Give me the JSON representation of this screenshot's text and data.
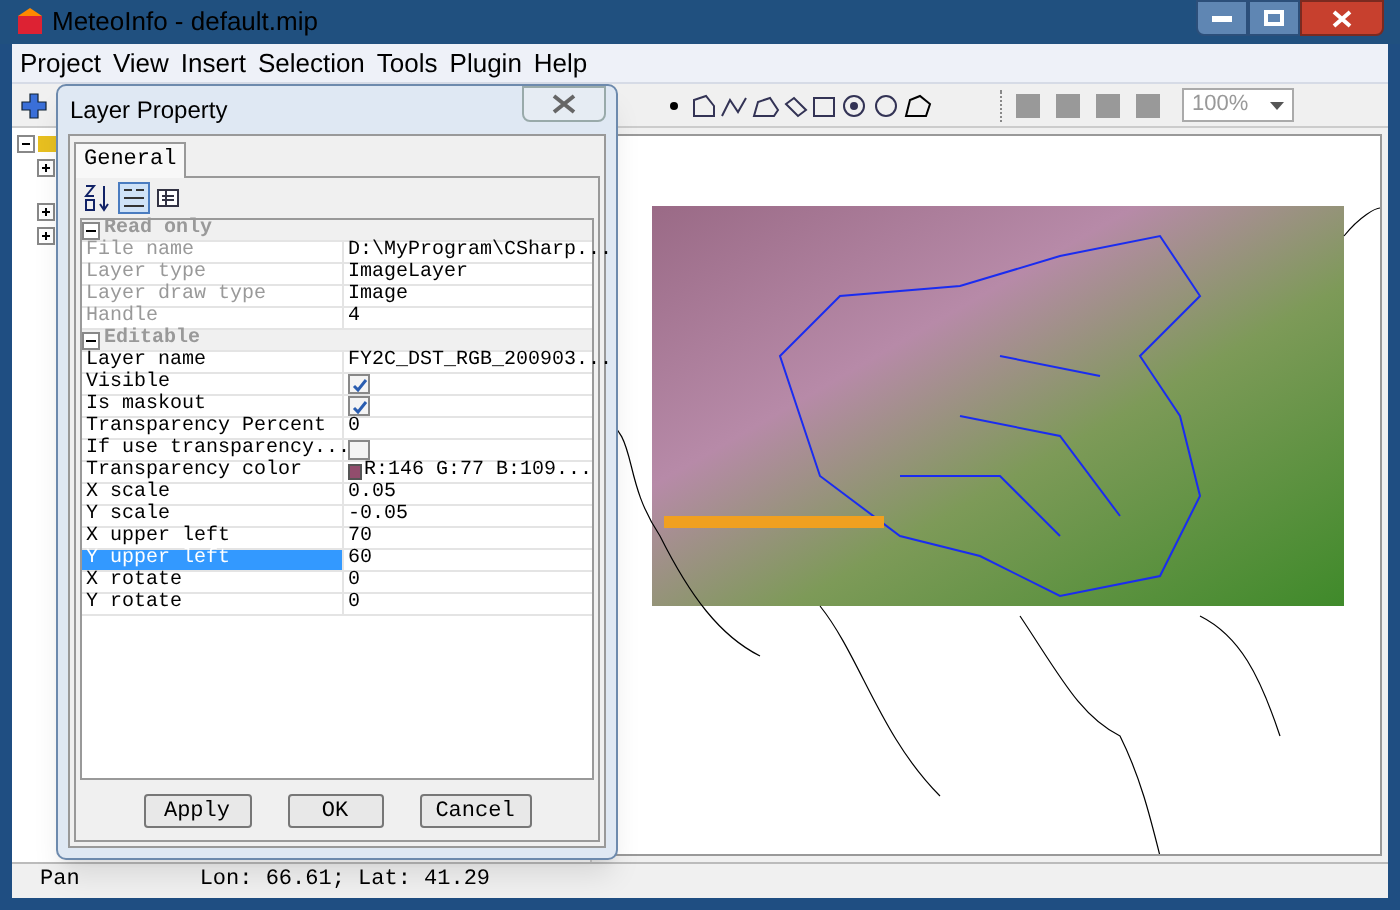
{
  "window": {
    "title": "MeteoInfo - default.mip"
  },
  "menu": [
    "Project",
    "View",
    "Insert",
    "Selection",
    "Tools",
    "Plugin",
    "Help"
  ],
  "toolbar": {
    "zoom": "100%"
  },
  "dialog": {
    "title": "Layer Property",
    "tabs": [
      {
        "label": "General",
        "selected": true
      }
    ],
    "groups": [
      {
        "title": "Read only",
        "expanded": true,
        "rows": [
          {
            "name": "File name",
            "value": "D:\\MyProgram\\CSharp...",
            "kind": "text",
            "disabled": true,
            "selected": false
          },
          {
            "name": "Layer type",
            "value": "ImageLayer",
            "kind": "text",
            "disabled": true,
            "selected": false
          },
          {
            "name": "Layer draw type",
            "value": "Image",
            "kind": "text",
            "disabled": true,
            "selected": false
          },
          {
            "name": "Handle",
            "value": "4",
            "kind": "text",
            "disabled": true,
            "selected": false
          }
        ]
      },
      {
        "title": "Editable",
        "expanded": true,
        "rows": [
          {
            "name": "Layer name",
            "value": "FY2C_DST_RGB_200903...",
            "kind": "text",
            "disabled": false,
            "selected": false
          },
          {
            "name": "Visible",
            "kind": "checkbox",
            "checked": true,
            "disabled": false,
            "selected": false
          },
          {
            "name": "Is maskout",
            "kind": "checkbox",
            "checked": true,
            "disabled": false,
            "selected": false
          },
          {
            "name": "Transparency Percent",
            "value": "0",
            "kind": "text",
            "disabled": false,
            "selected": false
          },
          {
            "name": "If use transparency...",
            "kind": "checkbox",
            "checked": false,
            "disabled": false,
            "selected": false
          },
          {
            "name": "Transparency color",
            "value": "R:146 G:77 B:109...",
            "kind": "color",
            "color": "#924d6d",
            "disabled": false,
            "selected": false
          },
          {
            "name": "X scale",
            "value": "0.05",
            "kind": "text",
            "disabled": false,
            "selected": false
          },
          {
            "name": "Y scale",
            "value": "-0.05",
            "kind": "text",
            "disabled": false,
            "selected": false
          },
          {
            "name": "X upper left",
            "value": "70",
            "kind": "text",
            "disabled": false,
            "selected": false
          },
          {
            "name": "Y upper left",
            "value": "60",
            "kind": "text",
            "disabled": false,
            "selected": true
          },
          {
            "name": "X rotate",
            "value": "0",
            "kind": "text",
            "disabled": false,
            "selected": false
          },
          {
            "name": "Y rotate",
            "value": "0",
            "kind": "text",
            "disabled": false,
            "selected": false
          }
        ]
      }
    ],
    "buttons": [
      "Apply",
      "OK",
      "Cancel"
    ]
  },
  "status_bar": {
    "mode": "Pan",
    "position": "Lon: 66.61; Lat: 41.29"
  }
}
